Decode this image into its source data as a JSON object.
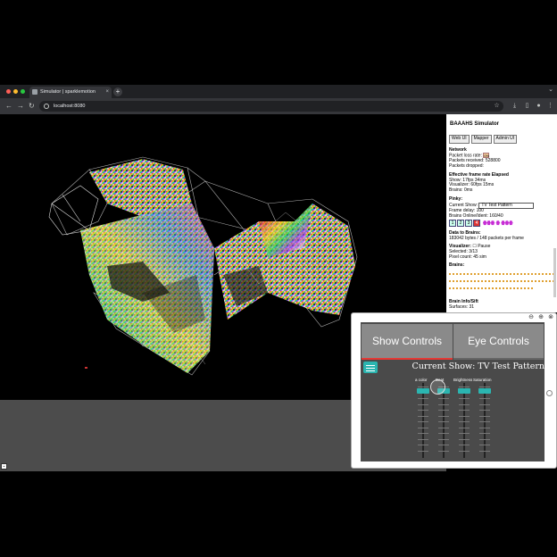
{
  "browser": {
    "tab_title": "Simulator | sparklemotion",
    "tab_close": "×",
    "new_tab": "+",
    "url": "localhost:8080",
    "back": "←",
    "forward": "→",
    "reload": "↻",
    "expand": "⌄"
  },
  "scene": {
    "collapse_marker": "⌄"
  },
  "panel": {
    "title": "BAAAHS Simulator",
    "tabs": [
      "Web UI",
      "Mapper",
      "Admin UI"
    ],
    "network": {
      "heading": "Network",
      "packet_loss_label": "Packet loss rate:",
      "packet_loss_value": "0%",
      "packets_received": "Packets received: 528800",
      "packets_dropped": "Packets dropped:"
    },
    "frame": {
      "heading": "Effective frame rate Elapsed",
      "show": "Show:       17fps   34ms",
      "visualizer": "Visualizer:   60fps   15ms",
      "brains": "Brains:      0ms"
    },
    "pinky": {
      "heading": "Pinky:",
      "current_show_label": "Current Show:",
      "current_show_value": "TV Test Pattern",
      "frame_delay": "Frame delay: 100",
      "brains_online": "Brains Online/Ident: 160/40",
      "buttons": [
        "1",
        "2",
        "3",
        "4"
      ],
      "glyphs": "ꙮꙮꙮ ꙮ ꙮꙮꙮ"
    },
    "data_to_brains": {
      "heading": "Data to Brains:",
      "value": "183042 bytes / 148 packets per frame"
    },
    "visualizer": {
      "heading": "Visualizer:",
      "paused_label": "Pause",
      "selected": "Selected: 3/13",
      "pixel_count": "Pixel count: 45 sim"
    },
    "brains_heading": "Brains:",
    "brain_log_heading": "Brain Info/Sift",
    "brain_log_value": "Surfaces: 31"
  },
  "overlay": {
    "zoom_out": "⊖",
    "zoom_in": "⊕",
    "close": "⊗",
    "show_controls": "Show Controls",
    "eye_controls": "Eye Controls",
    "current_show": "Current Show: TV Test Pattern",
    "sliders": [
      {
        "label": "a color",
        "value": 0.92
      },
      {
        "label": "Beat",
        "value": 0.92
      },
      {
        "label": "Brightness",
        "value": 0.92
      },
      {
        "label": "Saturation",
        "value": 0.92
      }
    ]
  },
  "colors": {
    "accent": "#2bb5b0",
    "tab_underline": "#e53935",
    "button_gray": "#8a8a8a"
  }
}
